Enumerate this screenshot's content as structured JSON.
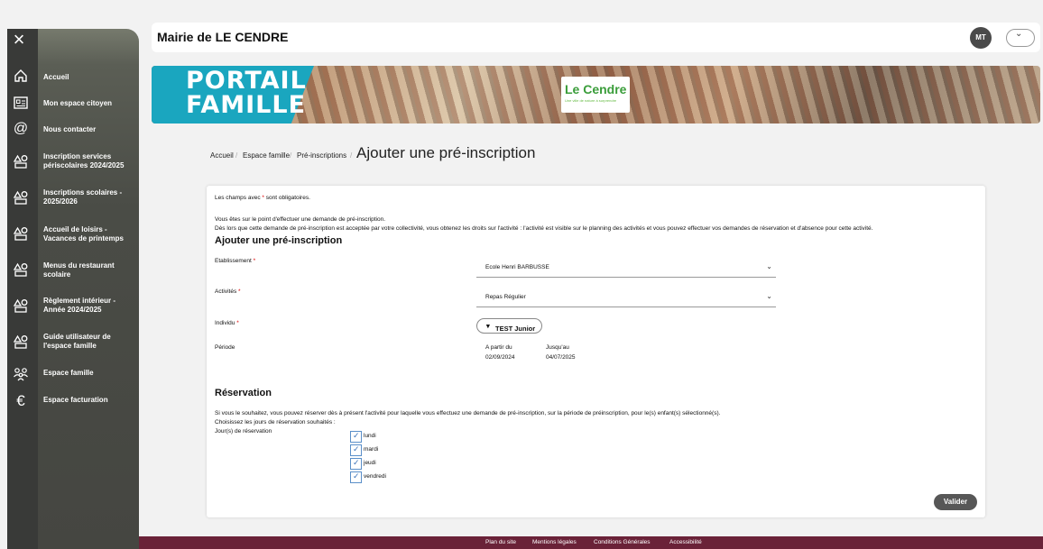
{
  "sidebar": {
    "close_glyph": "×",
    "items": [
      {
        "label": "Accueil",
        "icon": "home-icon"
      },
      {
        "label": "Mon espace citoyen",
        "icon": "id-card-icon"
      },
      {
        "label": "Nous contacter",
        "icon": "at-icon"
      },
      {
        "label": "Inscription services périscolaires 2024/2025",
        "icon": "shapes-icon"
      },
      {
        "label": "Inscriptions scolaires - 2025/2026",
        "icon": "shapes-icon"
      },
      {
        "label": "Accueil de loisirs - Vacances de printemps",
        "icon": "shapes-icon"
      },
      {
        "label": "Menus du restaurant scolaire",
        "icon": "shapes-icon"
      },
      {
        "label": "Règlement intérieur - Année 2024/2025",
        "icon": "shapes-icon"
      },
      {
        "label": "Guide utilisateur de l'espace famille",
        "icon": "shapes-icon"
      },
      {
        "label": "Espace famille",
        "icon": "family-icon"
      },
      {
        "label": "Espace facturation",
        "icon": "euro-icon"
      }
    ]
  },
  "header": {
    "title": "Mairie de LE CENDRE",
    "avatar_initials": "MT"
  },
  "banner": {
    "title_line1": "PORTAIL",
    "title_line2": "FAMILLE",
    "logo_text": "Le Cendre",
    "logo_sub": "Une ville de nature à surprendre"
  },
  "breadcrumb": {
    "items": [
      "Accueil",
      "Espace famille",
      "Pré-inscriptions"
    ],
    "current": "Ajouter une pré-inscription"
  },
  "form": {
    "required_note_before": "Les champs avec",
    "required_note_after": "sont obligatoires.",
    "intro_line1": "Vous êtes sur le point d'effectuer une demande de pré-inscription.",
    "intro_line2": "Dès lors que cette demande de pré-inscription est acceptée par votre collectivité, vous obtenez les droits sur l'activité : l'activité est visible sur le planning des activités et vous pouvez effectuer vos demandes de réservation et d'absence pour cette activité.",
    "section_title": "Ajouter une pré-inscription",
    "etablissement_label": "Etablissement",
    "etablissement_value": "Ecole Henri BARBUSSE",
    "activites_label": "Activités",
    "activites_value": "Repas Régulier",
    "individu_label": "Individu",
    "individu_value": "TEST Junior",
    "periode_label": "Période",
    "from_label": "A partir du",
    "from_value": "02/09/2024",
    "to_label": "Jusqu'au",
    "to_value": "04/07/2025",
    "reservation_title": "Réservation",
    "reservation_text": "Si vous le souhaitez, vous pouvez réserver dès à présent l'activité pour laquelle vous effectuez une demande de pré-inscription, sur la période de préinscription, pour le(s) enfant(s) sélectionné(s).",
    "choose_days": "Choisissez les jours de réservation souhaités :",
    "days_label": "Jour(s) de réservation",
    "days": [
      {
        "label": "lundi",
        "checked": true
      },
      {
        "label": "mardi",
        "checked": true
      },
      {
        "label": "jeudi",
        "checked": true
      },
      {
        "label": "vendredi",
        "checked": true
      }
    ],
    "submit_label": "Valider"
  },
  "footer": {
    "links": [
      "Plan du site",
      "Mentions légales",
      "Conditions Générales",
      "Accessibilité"
    ]
  },
  "colors": {
    "sidebar": "#4a4c46",
    "banner_accent": "#1aa6bf",
    "footer": "#6a2238",
    "required": "#dd0000"
  }
}
